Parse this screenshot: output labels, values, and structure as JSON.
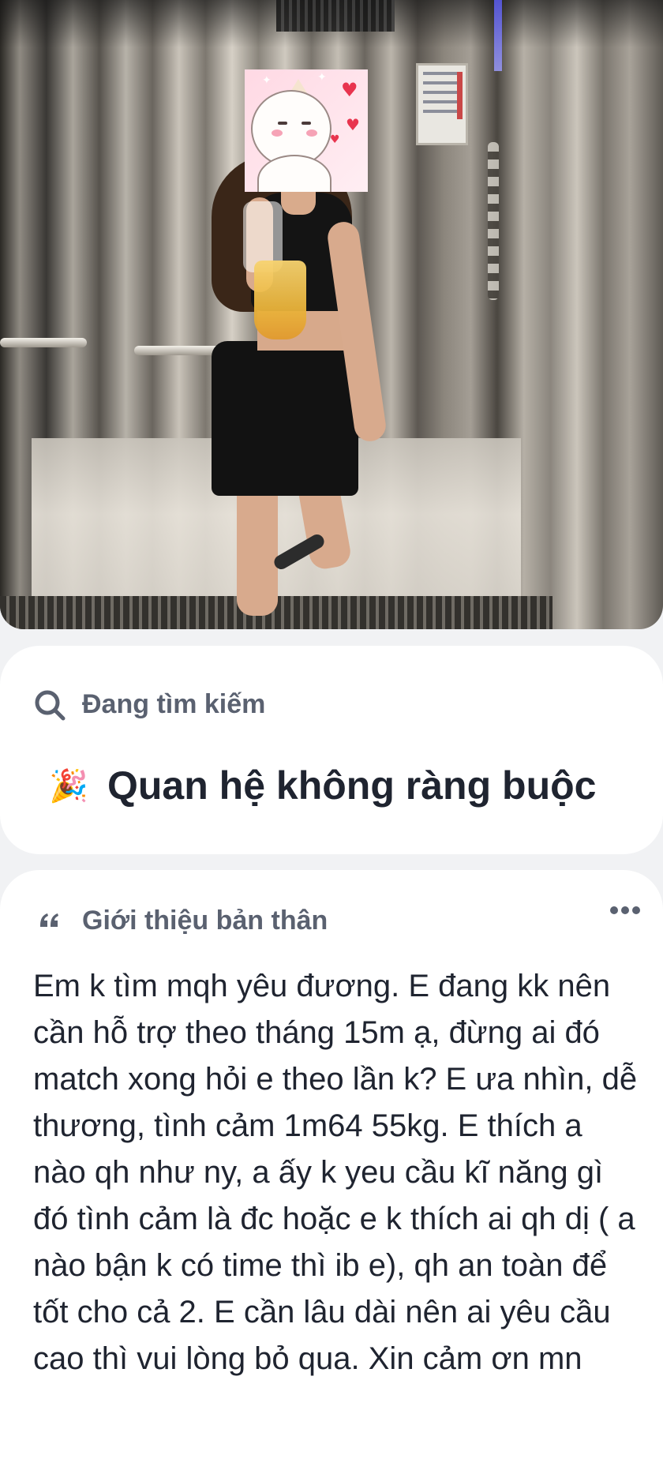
{
  "looking_for": {
    "label": "Đang tìm kiếm",
    "value": "Quan hệ không ràng buộc"
  },
  "intro": {
    "label": "Giới thiệu bản thân",
    "text": "Em k tìm mqh yêu đương. E đang kk nên cần hỗ trợ theo tháng 15m ạ, đừng ai đó match xong hỏi e theo lần k? E ưa nhìn, dễ thương, tình cảm 1m64 55kg. E thích a nào qh như ny, a ấy k yeu cầu kĩ năng gì đó tình cảm là đc hoặc e k thích ai qh dị ( a nào bận k có time thì ib e), qh an toàn để tốt cho cả 2. E cần lâu dài nên ai yêu cầu cao thì vui lòng bỏ qua. Xin cảm ơn mn"
  },
  "icons": {
    "looking_for": "search-icon",
    "value": "party-popper-icon",
    "intro": "quote-icon",
    "menu": "more-horizontal-icon"
  },
  "colors": {
    "background": "#f1f2f4",
    "card": "#ffffff",
    "label": "#5a6170",
    "text": "#1f2430"
  }
}
